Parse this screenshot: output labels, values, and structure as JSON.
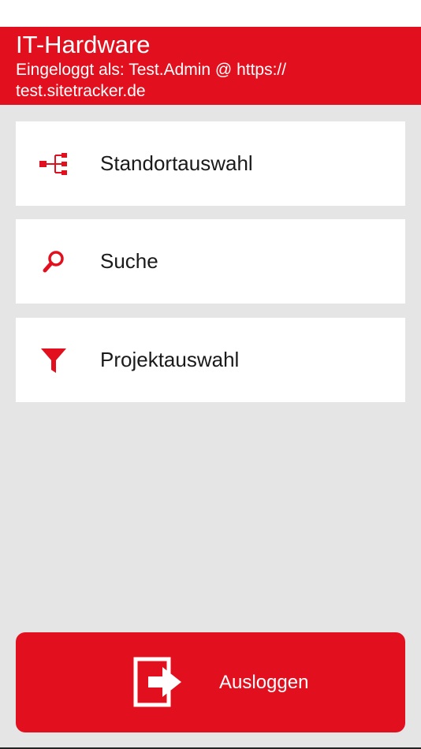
{
  "header": {
    "title": "IT-Hardware",
    "subtitle": "Eingeloggt als: Test.Admin @ https:// test.sitetracker.de"
  },
  "menu": {
    "items": [
      {
        "label": "Standortauswahl",
        "icon": "hierarchy-icon"
      },
      {
        "label": "Suche",
        "icon": "search-icon"
      },
      {
        "label": "Projektauswahl",
        "icon": "filter-icon"
      }
    ]
  },
  "logout": {
    "label": "Ausloggen",
    "icon": "logout-icon"
  },
  "colors": {
    "accent": "#e2101e",
    "background": "#e5e5e5",
    "card": "#ffffff"
  }
}
